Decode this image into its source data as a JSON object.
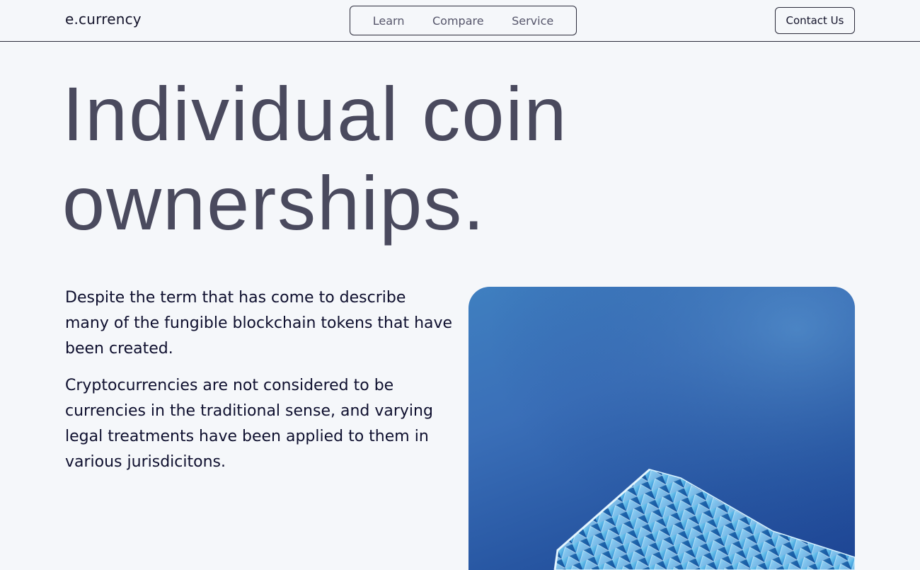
{
  "brand": {
    "logo": "e.currency"
  },
  "nav": {
    "items": [
      {
        "label": "Learn"
      },
      {
        "label": "Compare"
      },
      {
        "label": "Service"
      }
    ]
  },
  "header": {
    "contact_label": "Contact Us"
  },
  "hero": {
    "headline_line1": "Individual coin",
    "headline_line2": "ownerships.",
    "paragraph1": "Despite the term that has come to describe many of the fungible blockchain tokens that have been created.",
    "paragraph2": "Cryptocurrencies are not considered to be currencies in the traditional sense, and varying legal treatments have been applied to them in various jurisdicitons."
  },
  "colors": {
    "background": "#f5f7fa",
    "headline": "#4a4a5e",
    "body_text": "#0e0f2e",
    "image_sky": "#3a6fb8"
  }
}
